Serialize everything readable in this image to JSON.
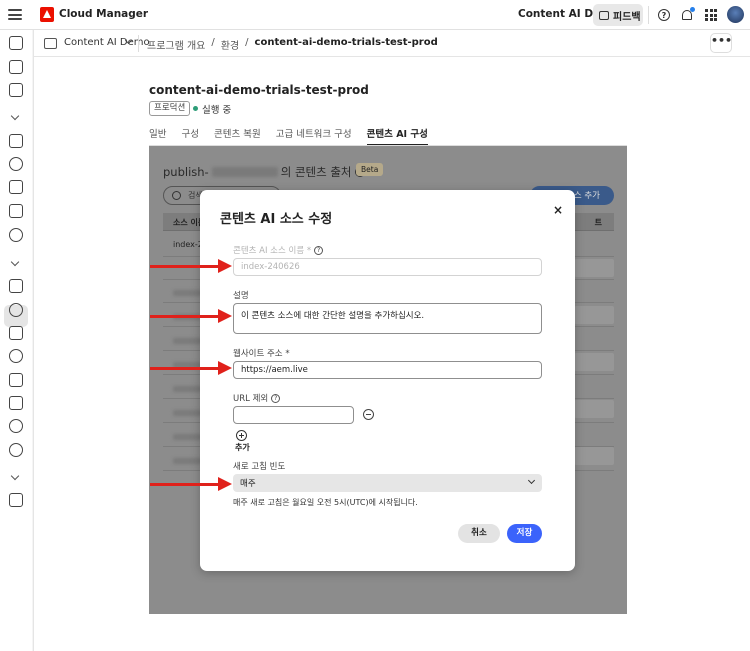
{
  "app": {
    "title": "Cloud Manager",
    "org": "Content AI Demo",
    "feedback_label": "피드백"
  },
  "breadcrumb_bar": {
    "context": "Content AI Demo",
    "items": [
      "프로그램 개요",
      "환경",
      "content-ai-demo-trials-test-prod"
    ],
    "separators": [
      "/",
      "/"
    ]
  },
  "environment": {
    "title": "content-ai-demo-trials-test-prod",
    "tag": "프로덕션",
    "status": "실행 중",
    "status_color": "#2d9d78",
    "tabs": [
      "일반",
      "구성",
      "콘텐츠 복원",
      "고급 네트워크 구성",
      "콘텐츠 AI 구성"
    ],
    "active_tab": "콘텐츠 AI 구성"
  },
  "panel": {
    "title_prefix": "publish-",
    "title_suffix": "의 콘텐츠 출처",
    "beta": "Beta",
    "search_placeholder": "검색",
    "add_button": "소스 추가",
    "col_name": "소스 이름",
    "col_right": "트",
    "first_row": "index-24"
  },
  "modal": {
    "title": "콘텐츠 AI 소스 수정",
    "close_glyph": "×",
    "fields": {
      "source_name": {
        "label": "콘텐츠 AI 소스 이름 *",
        "value": "index-240626",
        "disabled": true
      },
      "description": {
        "label": "설명",
        "value": "이 콘텐츠 소스에 대한 간단한 설명을 추가하십시오."
      },
      "website": {
        "label": "웹사이트 주소 *",
        "value": "https://aem.live"
      },
      "url_exclude": {
        "label": "URL 제외",
        "value": ""
      },
      "refresh": {
        "label": "새로 고침 빈도",
        "value": "매주"
      }
    },
    "add_label": "추가",
    "help_text": "매주 새로 고침은 월요일 오전 5시(UTC)에 시작됩니다.",
    "cancel_label": "취소",
    "save_label": "저장",
    "save_color": "#3b63fb"
  },
  "annotation": {
    "arrow_color": "#e0211b"
  }
}
